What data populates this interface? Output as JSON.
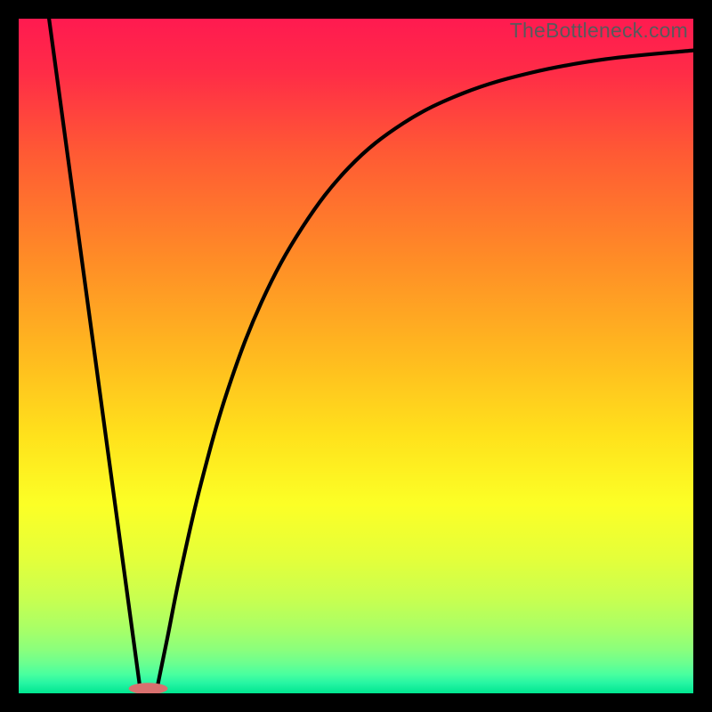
{
  "watermark": "TheBottleneck.com",
  "chart_data": {
    "type": "line",
    "title": "",
    "xlabel": "",
    "ylabel": "",
    "xlim": [
      0,
      100
    ],
    "ylim": [
      0,
      100
    ],
    "grid": false,
    "legend": null,
    "background": {
      "type": "vertical-gradient",
      "stops": [
        {
          "offset": 0.0,
          "color": "#ff1a50"
        },
        {
          "offset": 0.08,
          "color": "#ff2c47"
        },
        {
          "offset": 0.2,
          "color": "#ff5a34"
        },
        {
          "offset": 0.35,
          "color": "#ff8a27"
        },
        {
          "offset": 0.5,
          "color": "#ffba1f"
        },
        {
          "offset": 0.62,
          "color": "#ffe21c"
        },
        {
          "offset": 0.72,
          "color": "#fcff26"
        },
        {
          "offset": 0.8,
          "color": "#e4ff3a"
        },
        {
          "offset": 0.86,
          "color": "#c8ff50"
        },
        {
          "offset": 0.905,
          "color": "#a8ff67"
        },
        {
          "offset": 0.935,
          "color": "#8bff7c"
        },
        {
          "offset": 0.955,
          "color": "#6cff8f"
        },
        {
          "offset": 0.972,
          "color": "#48ff9f"
        },
        {
          "offset": 0.985,
          "color": "#26f5a3"
        },
        {
          "offset": 1.0,
          "color": "#00e690"
        }
      ]
    },
    "series": [
      {
        "name": "left-branch",
        "x": [
          4.5,
          18.0
        ],
        "y": [
          100.0,
          0.7
        ]
      },
      {
        "name": "right-branch",
        "x": [
          20.5,
          22,
          24,
          27,
          31,
          36,
          42,
          49,
          57,
          66,
          76,
          87,
          100
        ],
        "y": [
          0.7,
          8,
          18,
          31,
          45,
          58,
          69,
          78,
          84.5,
          89,
          92,
          94,
          95.3
        ]
      }
    ],
    "marker": {
      "name": "vertex-marker",
      "cx": 19.2,
      "cy": 0.7,
      "rx": 2.9,
      "ry": 0.85,
      "color": "#d9706f"
    }
  }
}
